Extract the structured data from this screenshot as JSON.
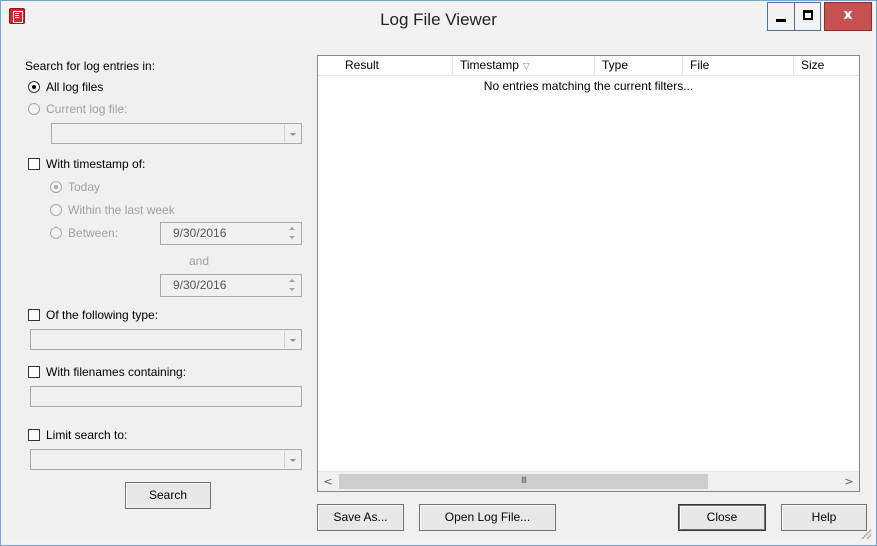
{
  "window": {
    "title": "Log File Viewer",
    "close_glyph": "x"
  },
  "search": {
    "heading": "Search for log entries in:",
    "all_logs_label": "All log files",
    "current_log_label": "Current log file:",
    "timestamp_label": "With timestamp of:",
    "today_label": "Today",
    "last_week_label": "Within the last week",
    "between_label": "Between:",
    "start_date": "9/30/2016",
    "and_label": "and",
    "end_date": "9/30/2016",
    "type_label": "Of the following type:",
    "filename_label": "With filenames containing:",
    "limit_label": "Limit search to:",
    "search_button": "Search"
  },
  "list": {
    "columns": [
      "Result",
      "Timestamp",
      "Type",
      "File",
      "Size"
    ],
    "sort_glyph": "▽",
    "empty_message": "No entries matching the current filters...",
    "thumb_glyph": "III",
    "left_arrow": "<",
    "right_arrow": ">"
  },
  "footer": {
    "save_as": "Save As...",
    "open_log": "Open Log File...",
    "close": "Close",
    "help": "Help"
  }
}
